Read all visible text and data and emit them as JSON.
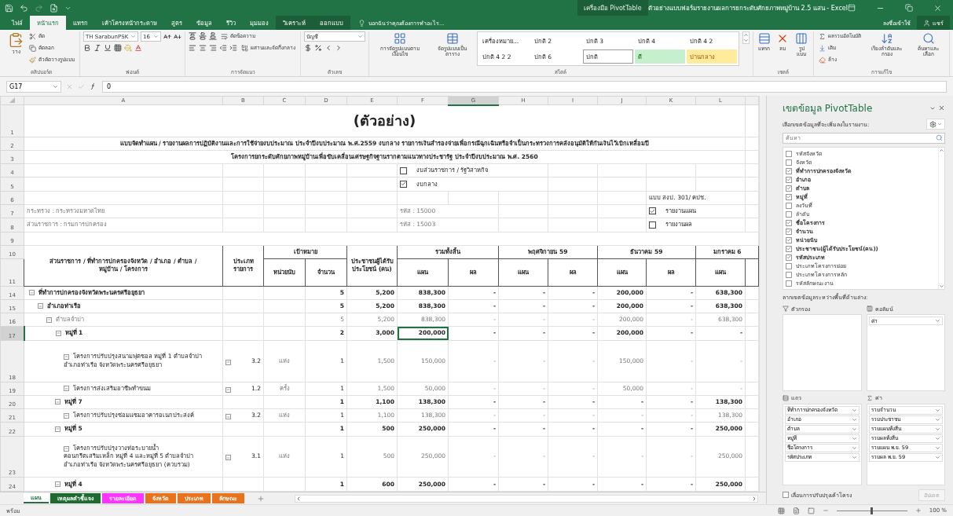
{
  "window": {
    "title": "ตัวอย่างแบบฟอร์มรายงานผลการยกระดับศักยภาพหมู่บ้าน 2.5 แสน - Excel",
    "contextual_group": "เครื่องมือ PivotTable",
    "sign_in": "ลงชื่อเข้าใช้",
    "share": "แชร์"
  },
  "ribbon_tabs": [
    {
      "label": "ไฟล์",
      "selected": false,
      "contextual": false
    },
    {
      "label": "หน้าแรก",
      "selected": true,
      "contextual": false
    },
    {
      "label": "แทรก",
      "selected": false,
      "contextual": false
    },
    {
      "label": "เค้าโครงหน้ากระดาษ",
      "selected": false,
      "contextual": false
    },
    {
      "label": "สูตร",
      "selected": false,
      "contextual": false
    },
    {
      "label": "ข้อมูล",
      "selected": false,
      "contextual": false
    },
    {
      "label": "รีวิว",
      "selected": false,
      "contextual": false
    },
    {
      "label": "มุมมอง",
      "selected": false,
      "contextual": false
    },
    {
      "label": "วิเคราะห์",
      "selected": false,
      "contextual": true
    },
    {
      "label": "ออกแบบ",
      "selected": false,
      "contextual": true
    }
  ],
  "tell_me": "บอกฉันว่าคุณต้องการทำอะไร...",
  "ribbon": {
    "clipboard": {
      "label": "คลิปบอร์ด",
      "paste": "วาง",
      "cut": "ตัด",
      "copy": "คัดลอก",
      "format_painter": "ตัวคัดวางรูปแบบ"
    },
    "font": {
      "label": "ฟอนต์",
      "name": "TH SarabunPSK",
      "size": "16"
    },
    "alignment": {
      "label": "การจัดแนว",
      "wrap": "ตัดข้อความ",
      "merge": "ผสานและจัดกึ่งกลาง"
    },
    "number": {
      "label": "ตัวเลข",
      "format": "บัญชี"
    },
    "styles": {
      "label": "สไตล์",
      "conditional": "การจัดรูปแบบตามเงื่อนไข",
      "format_table": "จัดรูปแบบเป็นตาราง",
      "cell_styles": [
        {
          "label": "เครื่องหมาย...",
          "kind": "plain"
        },
        {
          "label": "ปกติ 2",
          "kind": "plain"
        },
        {
          "label": "ปกติ 3",
          "kind": "plain"
        },
        {
          "label": "ปกติ 4",
          "kind": "plain"
        },
        {
          "label": "ปกติ 4 2",
          "kind": "plain"
        },
        {
          "label": "ปกติ 4 2 2",
          "kind": "plain"
        },
        {
          "label": "ปกติ 6",
          "kind": "plain"
        },
        {
          "label": "ปกติ",
          "kind": "current"
        },
        {
          "label": "ดี",
          "kind": "good"
        },
        {
          "label": "ปานกลาง",
          "kind": "neutral"
        }
      ]
    },
    "cells": {
      "label": "เซลล์",
      "buttons": [
        "แทรก",
        "ลบ",
        "รูปแบบ"
      ]
    },
    "editing": {
      "label": "การแก้ไข",
      "autosum": "ผลรวมอัตโนมัติ",
      "fill": "เติม",
      "clear": "ล้าง",
      "sort": "เรียงลำดับและกรอง",
      "find": "ค้นหาและเลือก"
    }
  },
  "formula_bar": {
    "name_box": "G17",
    "formula": "0"
  },
  "sheet": {
    "columns": [
      {
        "label": "A",
        "selected": false
      },
      {
        "label": "B",
        "selected": false
      },
      {
        "label": "C",
        "selected": false
      },
      {
        "label": "D",
        "selected": false
      },
      {
        "label": "E",
        "selected": false
      },
      {
        "label": "F",
        "selected": false
      },
      {
        "label": "G",
        "selected": true
      },
      {
        "label": "H",
        "selected": false
      },
      {
        "label": "I",
        "selected": false
      },
      {
        "label": "J",
        "selected": false
      },
      {
        "label": "K",
        "selected": false
      },
      {
        "label": "L",
        "selected": false
      }
    ],
    "top_rows": [
      {
        "label": "1",
        "selected": false
      },
      {
        "label": "2",
        "selected": false
      },
      {
        "label": "3",
        "selected": false
      },
      {
        "label": "4",
        "selected": false
      },
      {
        "label": "5",
        "selected": false
      },
      {
        "label": "6",
        "selected": false
      },
      {
        "label": "7",
        "selected": false
      },
      {
        "label": "8",
        "selected": false
      },
      {
        "label": "9",
        "selected": false
      },
      {
        "label": "10",
        "selected": false
      },
      {
        "label": "11",
        "selected": false
      }
    ],
    "title": "(ตัวอย่าง)",
    "subtitle_1": "แบบจัดทำแผน / รายงานผลการปฏิบัติงานและการใช้จ่ายงบประมาณ ประจำปีงบประมาณ พ.ศ.2559 งบกลาง รายการเงินสำรองจ่ายเพื่อกรณีฉุกเฉินหรือจำเป็นกระทรวงการคลังอนุมัติให้กันเงินไว้เบิกเหลื่อมปี",
    "subtitle_2": "โครงการยกระดับศักยภาพหมู่บ้านเพื่อขับเคลื่อนเศรษฐกิจฐานรากตามแนวทางประชารัฐ ประจำปีงบประมาณ พ.ศ. 2560",
    "budget_options": [
      {
        "label": "งบส่วนราชการ / รัฐวิสาหกิจ",
        "checked": false
      },
      {
        "label": "งบกลาง",
        "checked": true
      }
    ],
    "form_code": "แบบ สงป. 301/ คปช.",
    "ministry": "กระทรวง : กระทรวงมหาดไทย",
    "ministry_code": "รหัส : 15000",
    "department": "ส่วนราชการ : กรมการปกครอง",
    "department_code": "รหัส : 15003",
    "report_options": [
      {
        "label": "รายงานแผน",
        "checked": true
      },
      {
        "label": "รายงานผล",
        "checked": false
      }
    ],
    "header": {
      "entity": "ส่วนราชการ / ที่ทำการปกครองจังหวัด / อำเภอ / ตำบล / หมู่บ้าน / โครงการ",
      "type": "ประเภทรายการ",
      "target": "เป้าหมาย",
      "unit": "หน่วยนับ",
      "amount": "จำนวน",
      "beneficiaries": "ประชาชนผู้ได้รับประโยชน์ (คน)",
      "periods": [
        {
          "label": "รวมทั้งสิ้น",
          "plan": "แผน",
          "result": "ผล"
        },
        {
          "label": "พฤศจิกายน 59",
          "plan": "แผน",
          "result": "ผล"
        },
        {
          "label": "ธันวาคม 59",
          "plan": "แผน",
          "result": "ผล"
        },
        {
          "label": "มกราคม 6",
          "plan": "แผน"
        }
      ]
    },
    "rows": [
      {
        "row": "14",
        "selected": false,
        "kind": "province",
        "label": "ที่ทำการปกครองจังหวัดพระนครศรีอยุธยา",
        "amount": "5",
        "beneficiaries": "5,200",
        "values": [
          "838,300",
          "-",
          "-",
          "-",
          "200,000",
          "-",
          "638,300"
        ],
        "children": [
          {
            "row": "15",
            "selected": false,
            "kind": "district",
            "label": "อำเภอท่าเรือ",
            "amount": "5",
            "beneficiaries": "5,200",
            "values": [
              "838,300",
              "-",
              "-",
              "-",
              "200,000",
              "-",
              "638,300"
            ],
            "children": [
              {
                "row": "16",
                "selected": false,
                "kind": "subdistrict",
                "label": "ตำบลจำปา",
                "amount": "5",
                "beneficiaries": "5,200",
                "values": [
                  "838,300",
                  "-",
                  "-",
                  "-",
                  "200,000",
                  "-",
                  "638,300"
                ],
                "children": [
                  {
                    "row": "17",
                    "selected": true,
                    "kind": "village",
                    "label": "หมู่ที่ 1",
                    "amount": "2",
                    "beneficiaries": "3,000",
                    "values": [
                      "200,000",
                      "-",
                      "-",
                      "-",
                      "200,000",
                      "-",
                      "-"
                    ],
                    "children": [
                      {
                        "row": "18",
                        "selected": false,
                        "kind": "project",
                        "label": "โครงการปรับปรุงสนามฟุตซอล หมู่ที่ 1 ตำบลจำปา อำเภอท่าเรือ จังหวัดพระนครศรีอยุธยา",
                        "type": "3.2",
                        "unit": "แห่ง",
                        "amount": "1",
                        "beneficiaries": "1,500",
                        "values": [
                          "150,000",
                          "-",
                          "-",
                          "-",
                          "150,000",
                          "-",
                          "-"
                        ]
                      },
                      {
                        "row": "19",
                        "selected": false,
                        "kind": "project",
                        "label": "โครงการส่งเสริมอาชีพทำขนม",
                        "type": "1.2",
                        "unit": "ครั้ง",
                        "amount": "1",
                        "beneficiaries": "1,500",
                        "values": [
                          "50,000",
                          "-",
                          "-",
                          "-",
                          "50,000",
                          "-",
                          "-"
                        ]
                      }
                    ]
                  },
                  {
                    "row": "20",
                    "selected": false,
                    "kind": "village",
                    "label": "หมู่ที่ 7",
                    "amount": "1",
                    "beneficiaries": "1,100",
                    "values": [
                      "138,300",
                      "-",
                      "-",
                      "-",
                      "-",
                      "-",
                      "138,300"
                    ],
                    "children": [
                      {
                        "row": "21",
                        "selected": false,
                        "kind": "project",
                        "label": "โครงการปรับปรุงซ่อมแซมอาคารอเนกประสงค์",
                        "type": "3.2",
                        "unit": "แห่ง",
                        "amount": "1",
                        "beneficiaries": "1,100",
                        "values": [
                          "138,300",
                          "-",
                          "-",
                          "-",
                          "-",
                          "-",
                          "138,300"
                        ]
                      }
                    ]
                  },
                  {
                    "row": "22",
                    "selected": false,
                    "kind": "village",
                    "label": "หมู่ที่ 5",
                    "amount": "1",
                    "beneficiaries": "500",
                    "values": [
                      "250,000",
                      "-",
                      "-",
                      "-",
                      "-",
                      "-",
                      "250,000"
                    ],
                    "children": [
                      {
                        "row": "23",
                        "selected": false,
                        "kind": "project",
                        "label": "โครงการปรับปรุงวางท่อระบายน้ำคอนกรีตเสริมเหล็ก หมู่ที่ 4 และหมู่ที่ 5 ตำบลจำปา อำเภอท่าเรือ จังหวัดพระนครศรีอยุธยา (ควบรวม)",
                        "type": "3.1",
                        "unit": "แห่ง",
                        "amount": "1",
                        "beneficiaries": "500",
                        "values": [
                          "250,000",
                          "-",
                          "-",
                          "-",
                          "-",
                          "-",
                          "250,000"
                        ]
                      }
                    ]
                  },
                  {
                    "row": "24",
                    "selected": false,
                    "kind": "village",
                    "label": "หมู่ที่ 4",
                    "amount": "1",
                    "beneficiaries": "600",
                    "values": [
                      "250,000",
                      "-",
                      "-",
                      "-",
                      "-",
                      "-",
                      "250,000"
                    ]
                  }
                ]
              }
            ]
          }
        ]
      }
    ]
  },
  "sheet_tabs": [
    {
      "label": "แผน",
      "selected": true
    },
    {
      "label": "เหตุผลคำชี้แจง",
      "selected": false,
      "color": "#1e6b30"
    },
    {
      "label": "รายละเอียด",
      "selected": false,
      "color": "#ff33ff"
    },
    {
      "label": "จังหวัด",
      "selected": false,
      "color": "#e8731c"
    },
    {
      "label": "ประเภท",
      "selected": false,
      "color": "#e8731c"
    },
    {
      "label": "ลักษณะ",
      "selected": false,
      "color": "#e8731c"
    }
  ],
  "pivot": {
    "title": "เขตข้อมูล PivotTable",
    "subtitle": "เลือกเขตข้อมูลที่จะเพิ่มลงในรายงาน:",
    "search_placeholder": "ค้นหา",
    "fields": [
      {
        "label": "รหัสจังหวัด",
        "checked": false
      },
      {
        "label": "จังหวัด",
        "checked": false
      },
      {
        "label": "ที่ทำการปกครองจังหวัด",
        "checked": true
      },
      {
        "label": "อำเภอ",
        "checked": true
      },
      {
        "label": "ตำบล",
        "checked": true
      },
      {
        "label": "หมู่ที่",
        "checked": true
      },
      {
        "label": "ลงวันที่",
        "checked": false
      },
      {
        "label": "ลำดับ",
        "checked": false
      },
      {
        "label": "ชื่อโครงการ",
        "checked": true
      },
      {
        "label": "จำนวน",
        "checked": true
      },
      {
        "label": "หน่วยนับ",
        "checked": true
      },
      {
        "label": "ประชาชน(ผู้ได้รับประโยชน์(คน))",
        "checked": true
      },
      {
        "label": "รหัสประเภท",
        "checked": true
      },
      {
        "label": "ประเภทโครงการย่อย",
        "checked": false
      },
      {
        "label": "ประเภทโครงการหลัก",
        "checked": false
      },
      {
        "label": "รหัสลักษณะงาน",
        "checked": false
      }
    ],
    "drag_hint": "ลากเขตข้อมูลระหว่างพื้นที่ด้านล่าง:",
    "filters": {
      "label": "ตัวกรอง"
    },
    "columns": {
      "label": "คอลัมน์",
      "items": [
        "ค่า"
      ]
    },
    "rows": {
      "label": "แถว",
      "items": [
        "ที่ทำการปกครองจังหวัด",
        "อำเภอ",
        "ตำบล",
        "หมู่ที่",
        "ชื่อโครงการ",
        "รหัสประเภท"
      ]
    },
    "values": {
      "label": "ค่า",
      "items": [
        "รวมจำนวน",
        "รวมประชาชน",
        "รวมแผนทั้งสิ้น",
        "รวมผลทั้งสิ้น",
        "รวมแผน พ.ย. 59",
        "รวมผล พ.ย. 59"
      ]
    },
    "defer": {
      "label": "เลื่อนการปรับปรุงเค้าโครง",
      "checked": false
    },
    "update": {
      "label": "อัปเดต",
      "disabled": true
    }
  },
  "status": {
    "text": "พร้อม",
    "zoom": "100 %",
    "zoom_slider": {
      "level": 0.5
    }
  }
}
